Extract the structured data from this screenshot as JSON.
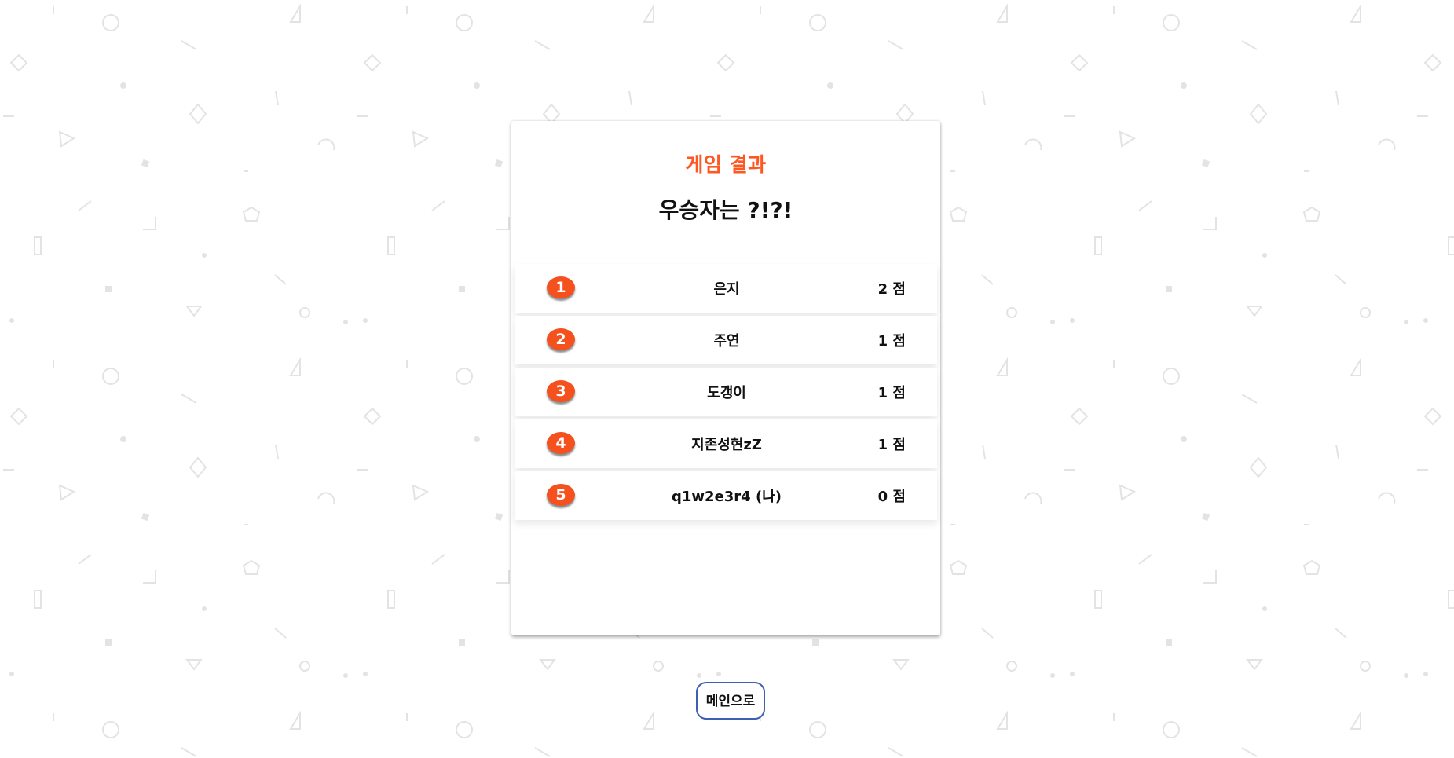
{
  "result": {
    "title": "게임 결과",
    "subtitle": "우승자는 ?!?!",
    "rankings": [
      {
        "rank": "1",
        "name": "은지",
        "score": "2 점"
      },
      {
        "rank": "2",
        "name": "주연",
        "score": "1 점"
      },
      {
        "rank": "3",
        "name": "도갱이",
        "score": "1 점"
      },
      {
        "rank": "4",
        "name": "지존성현zZ",
        "score": "1 점"
      },
      {
        "rank": "5",
        "name": "q1w2e3r4 (나)",
        "score": "0 점"
      }
    ]
  },
  "actions": {
    "main_button_label": "메인으로"
  },
  "colors": {
    "accent": "#ff5722",
    "badge": "#f4511e",
    "button_border": "#3f5fb0",
    "pattern": "#dcdcdc"
  }
}
